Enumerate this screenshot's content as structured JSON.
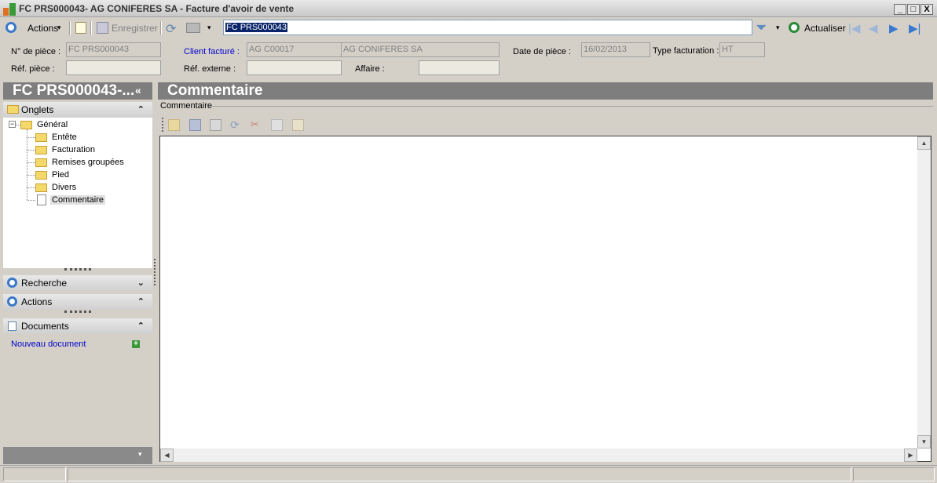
{
  "window": {
    "title": "FC PRS000043- AG CONIFERES SA -  Facture d'avoir de vente",
    "min_glyph": "_",
    "max_glyph": "□",
    "close_glyph": "X"
  },
  "toolbar": {
    "actions_label": "Actions",
    "save_label": "Enregistrer",
    "search_value": "FC PRS000043",
    "refresh_label": "Actualiser",
    "caret": "▾",
    "nav_first": "|◀",
    "nav_prev": "◀",
    "nav_next": "▶",
    "nav_last": "▶|"
  },
  "header_fields": {
    "num_piece_label": "N° de pièce :",
    "num_piece_value": "FC PRS000043",
    "ref_piece_label": "Réf. pièce :",
    "ref_piece_value": "",
    "client_label": "Client facturé :",
    "client_code": "AG C00017",
    "client_name": "AG CONIFERES SA",
    "ref_externe_label": "Réf. externe :",
    "ref_externe_value": "",
    "affaire_label": "Affaire :",
    "affaire_value": "",
    "date_label": "Date de  pièce :",
    "date_value": "16/02/2013",
    "type_label": "Type facturation :",
    "type_value": "HT"
  },
  "left_panel": {
    "title": "FC PRS000043-...",
    "collapse_glyph": "«",
    "onglets_label": "Onglets",
    "tree_root": "Général",
    "tree_expander": "−",
    "tree_children": [
      "Entête",
      "Facturation",
      "Remises groupées",
      "Pied",
      "Divers",
      "Commentaire"
    ],
    "selected_item": "Commentaire",
    "recherche_label": "Recherche",
    "actions_label": "Actions",
    "documents_label": "Documents",
    "new_document_label": "Nouveau document",
    "chev_up": "⌃",
    "chev_down": "⌄"
  },
  "main": {
    "title": "Commentaire",
    "group_label": "Commentaire",
    "editor_text": ""
  },
  "colors": {
    "header_bg": "#7e7e7e",
    "link": "#0000cc",
    "selection": "#0a246a"
  }
}
